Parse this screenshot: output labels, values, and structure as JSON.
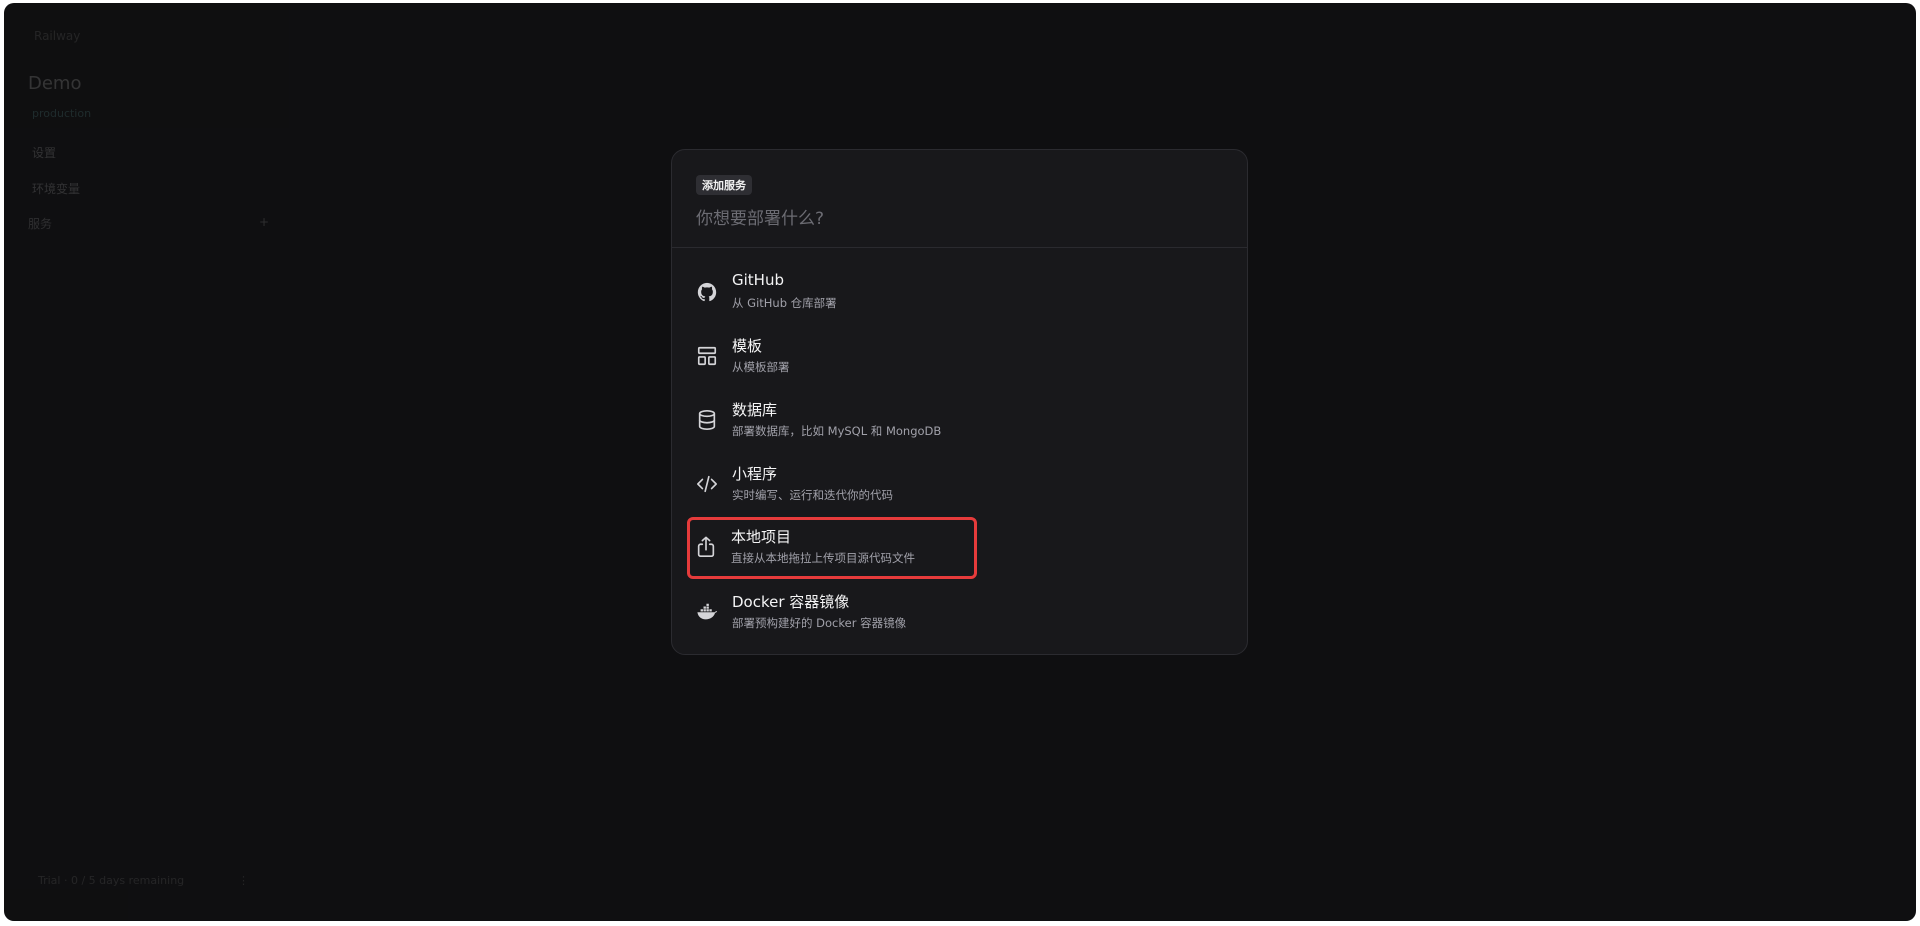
{
  "background": {
    "logo": "Railway",
    "project_name": "Demo",
    "environment": "production",
    "nav": [
      "设置",
      "环境变量"
    ],
    "section": {
      "label": "服务",
      "add": "+"
    },
    "footer": {
      "text": "Trial · 0 / 5 days remaining",
      "action": "⋮"
    }
  },
  "modal": {
    "tag": "添加服务",
    "search_placeholder": "你想要部署什么?",
    "options": [
      {
        "icon": "github-icon",
        "title": "GitHub",
        "desc": "从 GitHub 仓库部署"
      },
      {
        "icon": "template-icon",
        "title": "模板",
        "desc": "从模板部署"
      },
      {
        "icon": "database-icon",
        "title": "数据库",
        "desc": "部署数据库，比如 MySQL 和 MongoDB"
      },
      {
        "icon": "code-icon",
        "title": "小程序",
        "desc": "实时编写、运行和迭代你的代码"
      },
      {
        "icon": "upload-icon",
        "title": "本地项目",
        "desc": "直接从本地拖拉上传项目源代码文件"
      },
      {
        "icon": "docker-icon",
        "title": "Docker 容器镜像",
        "desc": "部署预构建好的 Docker 容器镜像"
      }
    ],
    "selected_index": 4
  },
  "colors": {
    "background": "#0f0f11",
    "modal": "#18181b",
    "highlight": "#e53b3b"
  }
}
